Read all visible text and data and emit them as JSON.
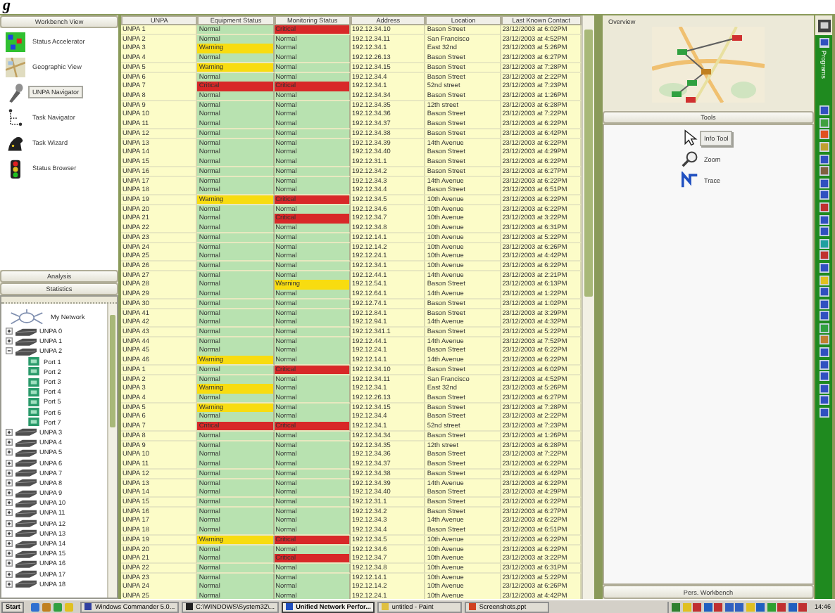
{
  "caption_fragment": "g",
  "left_panel": {
    "workbench_header": "Workbench View",
    "workbench_items": [
      {
        "label": "Status Accelerator",
        "kind": "grid",
        "selected": false
      },
      {
        "label": "Geographic View",
        "kind": "map",
        "selected": false
      },
      {
        "label": "UNPA Navigator",
        "kind": "probe",
        "selected": true
      },
      {
        "label": "Task Navigator",
        "kind": "tree",
        "selected": false
      },
      {
        "label": "Task Wizard",
        "kind": "hat",
        "selected": false
      },
      {
        "label": "Status Browser",
        "kind": "light",
        "selected": false
      }
    ],
    "section_headers": [
      "Analysis",
      "Statistics"
    ],
    "tree": {
      "root": "My Network",
      "items": [
        {
          "label": "UNPA 0",
          "expanded": false
        },
        {
          "label": "UNPA 1",
          "expanded": false
        },
        {
          "label": "UNPA 2",
          "expanded": true,
          "children": [
            {
              "label": "Port 1"
            },
            {
              "label": "Port 2"
            },
            {
              "label": "Port 3"
            },
            {
              "label": "Port 4"
            },
            {
              "label": "Port 5"
            },
            {
              "label": "Port 6"
            },
            {
              "label": "Port 7"
            }
          ]
        },
        {
          "label": "UNPA 3",
          "expanded": false
        },
        {
          "label": "UNPA 4",
          "expanded": false
        },
        {
          "label": "UNPA 5",
          "expanded": false
        },
        {
          "label": "UNPA 6",
          "expanded": false
        },
        {
          "label": "UNPA 7",
          "expanded": false
        },
        {
          "label": "UNPA 8",
          "expanded": false
        },
        {
          "label": "UNPA 9",
          "expanded": false
        },
        {
          "label": "UNPA 10",
          "expanded": false
        },
        {
          "label": "UNPA 11",
          "expanded": false
        },
        {
          "label": "UNPA 12",
          "expanded": false
        },
        {
          "label": "UNPA 13",
          "expanded": false
        },
        {
          "label": "UNPA 14",
          "expanded": false
        },
        {
          "label": "UNPA 15",
          "expanded": false
        },
        {
          "label": "UNPA 16",
          "expanded": false
        },
        {
          "label": "UNPA 17",
          "expanded": false
        },
        {
          "label": "UNPA 18",
          "expanded": false
        }
      ]
    }
  },
  "table": {
    "columns": [
      "UNPA",
      "Equipment Status",
      "Monitoring Status",
      "Address",
      "Location",
      "Last Known Contact"
    ],
    "rows": [
      {
        "unpa": "UNPA 1",
        "equipment": {
          "text": "Normal",
          "color": "#b8e2b0"
        },
        "monitoring": {
          "text": "Critical",
          "color": "#d82828"
        },
        "address": "192.12.34.10",
        "location": "Bason Street",
        "contact": "23/12/2003 at 6:02PM"
      },
      {
        "unpa": "UNPA 2",
        "equipment": {
          "text": "Normal",
          "color": "#b8e2b0"
        },
        "monitoring": {
          "text": "Normal",
          "color": "#b8e2b0"
        },
        "address": "192.12.34.11",
        "location": "San Francisco",
        "contact": "23/12/2003 at 4:52PM"
      },
      {
        "unpa": "UNPA 3",
        "equipment": {
          "text": "Warning",
          "color": "#f8dc10"
        },
        "monitoring": {
          "text": "Normal",
          "color": "#b8e2b0"
        },
        "address": "192.12.34.1",
        "location": "East 32nd",
        "contact": "23/12/2003 at 5:26PM"
      },
      {
        "unpa": "UNPA 4",
        "equipment": {
          "text": "Normal",
          "color": "#b8e2b0"
        },
        "monitoring": {
          "text": "Normal",
          "color": "#b8e2b0"
        },
        "address": "192.12.26.13",
        "location": "Bason Street",
        "contact": "23/12/2003 at 6:27PM"
      },
      {
        "unpa": "UNPA 5",
        "equipment": {
          "text": "Warning",
          "color": "#f8dc10"
        },
        "monitoring": {
          "text": "Normal",
          "color": "#b8e2b0"
        },
        "address": "192.12.34.15",
        "location": "Bason Street",
        "contact": "23/12/2003 at 7:28PM"
      },
      {
        "unpa": "UNPA 6",
        "equipment": {
          "text": "Normal",
          "color": "#b8e2b0"
        },
        "monitoring": {
          "text": "Normal",
          "color": "#b8e2b0"
        },
        "address": "192.12.34.4",
        "location": "Bason Street",
        "contact": "23/12/2003 at 2:22PM"
      },
      {
        "unpa": "UNPA 7",
        "equipment": {
          "text": "Critical",
          "color": "#d82828"
        },
        "monitoring": {
          "text": "Critical",
          "color": "#d82828"
        },
        "address": "192.12.34.1",
        "location": "52nd street",
        "contact": "23/12/2003 at 7:23PM"
      },
      {
        "unpa": "UNPA 8",
        "equipment": {
          "text": "Normal",
          "color": "#b8e2b0"
        },
        "monitoring": {
          "text": "Normal",
          "color": "#b8e2b0"
        },
        "address": "192.12.34.34",
        "location": "Bason Street",
        "contact": "23/12/2003 at 1:26PM"
      },
      {
        "unpa": "UNPA 9",
        "equipment": {
          "text": "Normal",
          "color": "#b8e2b0"
        },
        "monitoring": {
          "text": "Normal",
          "color": "#b8e2b0"
        },
        "address": "192.12.34.35",
        "location": "12th street",
        "contact": "23/12/2003 at 6:28PM"
      },
      {
        "unpa": "UNPA 10",
        "equipment": {
          "text": "Normal",
          "color": "#b8e2b0"
        },
        "monitoring": {
          "text": "Normal",
          "color": "#b8e2b0"
        },
        "address": "192.12.34.36",
        "location": "Bason Street",
        "contact": "23/12/2003 at 7:22PM"
      },
      {
        "unpa": "UNPA 11",
        "equipment": {
          "text": "Normal",
          "color": "#b8e2b0"
        },
        "monitoring": {
          "text": "Normal",
          "color": "#b8e2b0"
        },
        "address": "192.12.34.37",
        "location": "Bason Street",
        "contact": "23/12/2003 at 6:22PM"
      },
      {
        "unpa": "UNPA 12",
        "equipment": {
          "text": "Normal",
          "color": "#b8e2b0"
        },
        "monitoring": {
          "text": "Normal",
          "color": "#b8e2b0"
        },
        "address": "192.12.34.38",
        "location": "Bason Street",
        "contact": "23/12/2003 at 6:42PM"
      },
      {
        "unpa": "UNPA 13",
        "equipment": {
          "text": "Normal",
          "color": "#b8e2b0"
        },
        "monitoring": {
          "text": "Normal",
          "color": "#b8e2b0"
        },
        "address": "192.12.34.39",
        "location": "14th Avenue",
        "contact": "23/12/2003 at 6:22PM"
      },
      {
        "unpa": "UNPA 14",
        "equipment": {
          "text": "Normal",
          "color": "#b8e2b0"
        },
        "monitoring": {
          "text": "Normal",
          "color": "#b8e2b0"
        },
        "address": "192.12.34.40",
        "location": "Bason Street",
        "contact": "23/12/2003 at 4:29PM"
      },
      {
        "unpa": "UNPA 15",
        "equipment": {
          "text": "Normal",
          "color": "#b8e2b0"
        },
        "monitoring": {
          "text": "Normal",
          "color": "#b8e2b0"
        },
        "address": "192.12.31.1",
        "location": "Bason Street",
        "contact": "23/12/2003 at 6:22PM"
      },
      {
        "unpa": "UNPA 16",
        "equipment": {
          "text": "Normal",
          "color": "#b8e2b0"
        },
        "monitoring": {
          "text": "Normal",
          "color": "#b8e2b0"
        },
        "address": "192.12.34.2",
        "location": "Bason Street",
        "contact": "23/12/2003 at 6:27PM"
      },
      {
        "unpa": "UNPA 17",
        "equipment": {
          "text": "Normal",
          "color": "#b8e2b0"
        },
        "monitoring": {
          "text": "Normal",
          "color": "#b8e2b0"
        },
        "address": "192.12.34.3",
        "location": "14th Avenue",
        "contact": "23/12/2003 at 6:22PM"
      },
      {
        "unpa": "UNPA 18",
        "equipment": {
          "text": "Normal",
          "color": "#b8e2b0"
        },
        "monitoring": {
          "text": "Normal",
          "color": "#b8e2b0"
        },
        "address": "192.12.34.4",
        "location": "Bason Street",
        "contact": "23/12/2003 at 6:51PM"
      },
      {
        "unpa": "UNPA 19",
        "equipment": {
          "text": "Warning",
          "color": "#f8dc10"
        },
        "monitoring": {
          "text": "Critical",
          "color": "#d82828"
        },
        "address": "192.12.34.5",
        "location": "10th Avenue",
        "contact": "23/12/2003 at 6:22PM"
      },
      {
        "unpa": "UNPA 20",
        "equipment": {
          "text": "Normal",
          "color": "#b8e2b0"
        },
        "monitoring": {
          "text": "Normal",
          "color": "#b8e2b0"
        },
        "address": "192.12.34.6",
        "location": "10th Avenue",
        "contact": "23/12/2003 at 6:22PM"
      },
      {
        "unpa": "UNPA 21",
        "equipment": {
          "text": "Normal",
          "color": "#b8e2b0"
        },
        "monitoring": {
          "text": "Critical",
          "color": "#d82828"
        },
        "address": "192.12.34.7",
        "location": "10th Avenue",
        "contact": "23/12/2003 at 3:22PM"
      },
      {
        "unpa": "UNPA 22",
        "equipment": {
          "text": "Normal",
          "color": "#b8e2b0"
        },
        "monitoring": {
          "text": "Normal",
          "color": "#b8e2b0"
        },
        "address": "192.12.34.8",
        "location": "10th Avenue",
        "contact": "23/12/2003 at 6:31PM"
      },
      {
        "unpa": "UNPA 23",
        "equipment": {
          "text": "Normal",
          "color": "#b8e2b0"
        },
        "monitoring": {
          "text": "Normal",
          "color": "#b8e2b0"
        },
        "address": "192.12.14.1",
        "location": "10th Avenue",
        "contact": "23/12/2003 at 5:22PM"
      },
      {
        "unpa": "UNPA 24",
        "equipment": {
          "text": "Normal",
          "color": "#b8e2b0"
        },
        "monitoring": {
          "text": "Normal",
          "color": "#b8e2b0"
        },
        "address": "192.12.14.2",
        "location": "10th Avenue",
        "contact": "23/12/2003 at 6:26PM"
      },
      {
        "unpa": "UNPA 25",
        "equipment": {
          "text": "Normal",
          "color": "#b8e2b0"
        },
        "monitoring": {
          "text": "Normal",
          "color": "#b8e2b0"
        },
        "address": "192.12.24.1",
        "location": "10th Avenue",
        "contact": "23/12/2003 at 4:42PM"
      },
      {
        "unpa": "UNPA 26",
        "equipment": {
          "text": "Normal",
          "color": "#b8e2b0"
        },
        "monitoring": {
          "text": "Normal",
          "color": "#b8e2b0"
        },
        "address": "192.12.34.1",
        "location": "10th Avenue",
        "contact": "23/12/2003 at 6:22PM"
      },
      {
        "unpa": "UNPA 27",
        "equipment": {
          "text": "Normal",
          "color": "#b8e2b0"
        },
        "monitoring": {
          "text": "Normal",
          "color": "#b8e2b0"
        },
        "address": "192.12.44.1",
        "location": "14th Avenue",
        "contact": "23/12/2003 at 2:21PM"
      },
      {
        "unpa": "UNPA 28",
        "equipment": {
          "text": "Normal",
          "color": "#b8e2b0"
        },
        "monitoring": {
          "text": "Warning",
          "color": "#f8dc10"
        },
        "address": "192.12.54.1",
        "location": "Bason Street",
        "contact": "23/12/2003 at 6:13PM"
      },
      {
        "unpa": "UNPA 29",
        "equipment": {
          "text": "Normal",
          "color": "#b8e2b0"
        },
        "monitoring": {
          "text": "Normal",
          "color": "#b8e2b0"
        },
        "address": "192.12.64.1",
        "location": "14th Avenue",
        "contact": "23/12/2003 at 1:22PM"
      },
      {
        "unpa": "UNPA 30",
        "equipment": {
          "text": "Normal",
          "color": "#b8e2b0"
        },
        "monitoring": {
          "text": "Normal",
          "color": "#b8e2b0"
        },
        "address": "192.12.74.1",
        "location": "Bason Street",
        "contact": "23/12/2003 at 1:02PM"
      },
      {
        "unpa": "UNPA 41",
        "equipment": {
          "text": "Normal",
          "color": "#b8e2b0"
        },
        "monitoring": {
          "text": "Normal",
          "color": "#b8e2b0"
        },
        "address": "192.12.84.1",
        "location": "Bason Street",
        "contact": "23/12/2003 at 3:29PM"
      },
      {
        "unpa": "UNPA 42",
        "equipment": {
          "text": "Normal",
          "color": "#b8e2b0"
        },
        "monitoring": {
          "text": "Normal",
          "color": "#b8e2b0"
        },
        "address": "192.12.94.1",
        "location": "14th Avenue",
        "contact": "23/12/2003 at 4:32PM"
      },
      {
        "unpa": "UNPA 43",
        "equipment": {
          "text": "Normal",
          "color": "#b8e2b0"
        },
        "monitoring": {
          "text": "Normal",
          "color": "#b8e2b0"
        },
        "address": "192.12.341.1",
        "location": "Bason Street",
        "contact": "23/12/2003 at 5:22PM"
      },
      {
        "unpa": "UNPA 44",
        "equipment": {
          "text": "Normal",
          "color": "#b8e2b0"
        },
        "monitoring": {
          "text": "Normal",
          "color": "#b8e2b0"
        },
        "address": "192.12.44.1",
        "location": "14th Avenue",
        "contact": "23/12/2003 at 7:52PM"
      },
      {
        "unpa": "UNPA 45",
        "equipment": {
          "text": "Normal",
          "color": "#b8e2b0"
        },
        "monitoring": {
          "text": "Normal",
          "color": "#b8e2b0"
        },
        "address": "192.12.24.1",
        "location": "Bason Street",
        "contact": "23/12/2003 at 6:22PM"
      },
      {
        "unpa": "UNPA 46",
        "equipment": {
          "text": "Warning",
          "color": "#f8dc10"
        },
        "monitoring": {
          "text": "Normal",
          "color": "#b8e2b0"
        },
        "address": "192.12.14.1",
        "location": "14th Avenue",
        "contact": "23/12/2003 at 6:22PM"
      },
      {
        "unpa": "UNPA 1",
        "equipment": {
          "text": "Normal",
          "color": "#b8e2b0"
        },
        "monitoring": {
          "text": "Critical",
          "color": "#d82828"
        },
        "address": "192.12.34.10",
        "location": "Bason Street",
        "contact": "23/12/2003 at 6:02PM"
      },
      {
        "unpa": "UNPA 2",
        "equipment": {
          "text": "Normal",
          "color": "#b8e2b0"
        },
        "monitoring": {
          "text": "Normal",
          "color": "#b8e2b0"
        },
        "address": "192.12.34.11",
        "location": "San Francisco",
        "contact": "23/12/2003 at 4:52PM"
      },
      {
        "unpa": "UNPA 3",
        "equipment": {
          "text": "Warning",
          "color": "#f8dc10"
        },
        "monitoring": {
          "text": "Normal",
          "color": "#b8e2b0"
        },
        "address": "192.12.34.1",
        "location": "East 32nd",
        "contact": "23/12/2003 at 5:26PM"
      },
      {
        "unpa": "UNPA 4",
        "equipment": {
          "text": "Normal",
          "color": "#b8e2b0"
        },
        "monitoring": {
          "text": "Normal",
          "color": "#b8e2b0"
        },
        "address": "192.12.26.13",
        "location": "Bason Street",
        "contact": "23/12/2003 at 6:27PM"
      },
      {
        "unpa": "UNPA 5",
        "equipment": {
          "text": "Warning",
          "color": "#f8dc10"
        },
        "monitoring": {
          "text": "Normal",
          "color": "#b8e2b0"
        },
        "address": "192.12.34.15",
        "location": "Bason Street",
        "contact": "23/12/2003 at 7:28PM"
      },
      {
        "unpa": "UNPA 6",
        "equipment": {
          "text": "Normal",
          "color": "#b8e2b0"
        },
        "monitoring": {
          "text": "Normal",
          "color": "#b8e2b0"
        },
        "address": "192.12.34.4",
        "location": "Bason Street",
        "contact": "23/12/2003 at 2:22PM"
      },
      {
        "unpa": "UNPA 7",
        "equipment": {
          "text": "Critical",
          "color": "#d82828"
        },
        "monitoring": {
          "text": "Critical",
          "color": "#d82828"
        },
        "address": "192.12.34.1",
        "location": "52nd street",
        "contact": "23/12/2003 at 7:23PM"
      },
      {
        "unpa": "UNPA 8",
        "equipment": {
          "text": "Normal",
          "color": "#b8e2b0"
        },
        "monitoring": {
          "text": "Normal",
          "color": "#b8e2b0"
        },
        "address": "192.12.34.34",
        "location": "Bason Street",
        "contact": "23/12/2003 at 1:26PM"
      },
      {
        "unpa": "UNPA 9",
        "equipment": {
          "text": "Normal",
          "color": "#b8e2b0"
        },
        "monitoring": {
          "text": "Normal",
          "color": "#b8e2b0"
        },
        "address": "192.12.34.35",
        "location": "12th street",
        "contact": "23/12/2003 at 6:28PM"
      },
      {
        "unpa": "UNPA 10",
        "equipment": {
          "text": "Normal",
          "color": "#b8e2b0"
        },
        "monitoring": {
          "text": "Normal",
          "color": "#b8e2b0"
        },
        "address": "192.12.34.36",
        "location": "Bason Street",
        "contact": "23/12/2003 at 7:22PM"
      },
      {
        "unpa": "UNPA 11",
        "equipment": {
          "text": "Normal",
          "color": "#b8e2b0"
        },
        "monitoring": {
          "text": "Normal",
          "color": "#b8e2b0"
        },
        "address": "192.12.34.37",
        "location": "Bason Street",
        "contact": "23/12/2003 at 6:22PM"
      },
      {
        "unpa": "UNPA 12",
        "equipment": {
          "text": "Normal",
          "color": "#b8e2b0"
        },
        "monitoring": {
          "text": "Normal",
          "color": "#b8e2b0"
        },
        "address": "192.12.34.38",
        "location": "Bason Street",
        "contact": "23/12/2003 at 6:42PM"
      },
      {
        "unpa": "UNPA 13",
        "equipment": {
          "text": "Normal",
          "color": "#b8e2b0"
        },
        "monitoring": {
          "text": "Normal",
          "color": "#b8e2b0"
        },
        "address": "192.12.34.39",
        "location": "14th Avenue",
        "contact": "23/12/2003 at 6:22PM"
      },
      {
        "unpa": "UNPA 14",
        "equipment": {
          "text": "Normal",
          "color": "#b8e2b0"
        },
        "monitoring": {
          "text": "Normal",
          "color": "#b8e2b0"
        },
        "address": "192.12.34.40",
        "location": "Bason Street",
        "contact": "23/12/2003 at 4:29PM"
      },
      {
        "unpa": "UNPA 15",
        "equipment": {
          "text": "Normal",
          "color": "#b8e2b0"
        },
        "monitoring": {
          "text": "Normal",
          "color": "#b8e2b0"
        },
        "address": "192.12.31.1",
        "location": "Bason Street",
        "contact": "23/12/2003 at 6:22PM"
      },
      {
        "unpa": "UNPA 16",
        "equipment": {
          "text": "Normal",
          "color": "#b8e2b0"
        },
        "monitoring": {
          "text": "Normal",
          "color": "#b8e2b0"
        },
        "address": "192.12.34.2",
        "location": "Bason Street",
        "contact": "23/12/2003 at 6:27PM"
      },
      {
        "unpa": "UNPA 17",
        "equipment": {
          "text": "Normal",
          "color": "#b8e2b0"
        },
        "monitoring": {
          "text": "Normal",
          "color": "#b8e2b0"
        },
        "address": "192.12.34.3",
        "location": "14th Avenue",
        "contact": "23/12/2003 at 6:22PM"
      },
      {
        "unpa": "UNPA 18",
        "equipment": {
          "text": "Normal",
          "color": "#b8e2b0"
        },
        "monitoring": {
          "text": "Normal",
          "color": "#b8e2b0"
        },
        "address": "192.12.34.4",
        "location": "Bason Street",
        "contact": "23/12/2003 at 6:51PM"
      },
      {
        "unpa": "UNPA 19",
        "equipment": {
          "text": "Warning",
          "color": "#f8dc10"
        },
        "monitoring": {
          "text": "Critical",
          "color": "#d82828"
        },
        "address": "192.12.34.5",
        "location": "10th Avenue",
        "contact": "23/12/2003 at 6:22PM"
      },
      {
        "unpa": "UNPA 20",
        "equipment": {
          "text": "Normal",
          "color": "#b8e2b0"
        },
        "monitoring": {
          "text": "Normal",
          "color": "#b8e2b0"
        },
        "address": "192.12.34.6",
        "location": "10th Avenue",
        "contact": "23/12/2003 at 6:22PM"
      },
      {
        "unpa": "UNPA 21",
        "equipment": {
          "text": "Normal",
          "color": "#b8e2b0"
        },
        "monitoring": {
          "text": "Critical",
          "color": "#d82828"
        },
        "address": "192.12.34.7",
        "location": "10th Avenue",
        "contact": "23/12/2003 at 3:22PM"
      },
      {
        "unpa": "UNPA 22",
        "equipment": {
          "text": "Normal",
          "color": "#b8e2b0"
        },
        "monitoring": {
          "text": "Normal",
          "color": "#b8e2b0"
        },
        "address": "192.12.34.8",
        "location": "10th Avenue",
        "contact": "23/12/2003 at 6:31PM"
      },
      {
        "unpa": "UNPA 23",
        "equipment": {
          "text": "Normal",
          "color": "#b8e2b0"
        },
        "monitoring": {
          "text": "Normal",
          "color": "#b8e2b0"
        },
        "address": "192.12.14.1",
        "location": "10th Avenue",
        "contact": "23/12/2003 at 5:22PM"
      },
      {
        "unpa": "UNPA 24",
        "equipment": {
          "text": "Normal",
          "color": "#b8e2b0"
        },
        "monitoring": {
          "text": "Normal",
          "color": "#b8e2b0"
        },
        "address": "192.12.14.2",
        "location": "10th Avenue",
        "contact": "23/12/2003 at 6:26PM"
      },
      {
        "unpa": "UNPA 25",
        "equipment": {
          "text": "Normal",
          "color": "#b8e2b0"
        },
        "monitoring": {
          "text": "Normal",
          "color": "#b8e2b0"
        },
        "address": "192.12.24.1",
        "location": "10th Avenue",
        "contact": "23/12/2003 at 4:42PM"
      }
    ]
  },
  "right_panel": {
    "overview_label": "Overview",
    "tools_header": "Tools",
    "tools": [
      {
        "label": "Info Tool",
        "kind": "pointer",
        "selected": true
      },
      {
        "label": "Zoom",
        "kind": "zoom",
        "selected": false
      },
      {
        "label": "Trace",
        "kind": "trace",
        "selected": false
      }
    ],
    "footer_button": "Pers. Workbench"
  },
  "programs_bar": {
    "label": "Programs"
  },
  "taskbar": {
    "start": "Start",
    "tasks": [
      {
        "label": "Windows Commander 5.0...",
        "kind": "commander",
        "selected": false
      },
      {
        "label": "C:\\WINDOWS\\System32\\...",
        "kind": "console",
        "selected": false
      },
      {
        "label": "Unified Network Perfor...",
        "kind": "app",
        "selected": true
      },
      {
        "label": "untitled - Paint",
        "kind": "paint",
        "selected": false
      },
      {
        "label": "Screenshots.ppt",
        "kind": "slides",
        "selected": false
      }
    ],
    "clock": "14:46"
  }
}
